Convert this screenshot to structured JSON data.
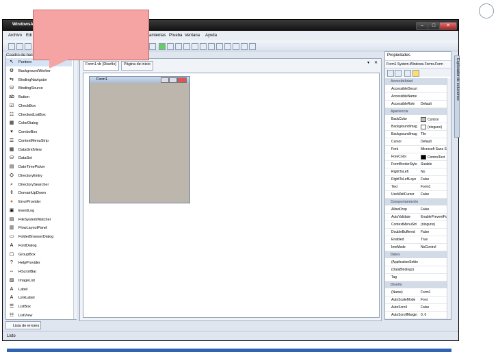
{
  "window": {
    "title": "WindowsAp",
    "min": "–",
    "max": "□",
    "close": "✕"
  },
  "menu": [
    "Archivo",
    "Edi",
    "ramientas",
    "Prueba",
    "Ventana",
    "Ayuda"
  ],
  "toolbox": {
    "header": "Cuadro de herra",
    "items": [
      {
        "label": "Puntero",
        "icon": "pointer-icon",
        "glyph": "↖"
      },
      {
        "label": "BackgroundWorker",
        "icon": "worker-icon",
        "glyph": "⚙"
      },
      {
        "label": "BindingNavigator",
        "icon": "navigator-icon",
        "glyph": "⇆"
      },
      {
        "label": "BindingSource",
        "icon": "source-icon",
        "glyph": "⛁"
      },
      {
        "label": "Button",
        "icon": "button-icon",
        "glyph": "ab"
      },
      {
        "label": "CheckBox",
        "icon": "checkbox-icon",
        "glyph": "☑"
      },
      {
        "label": "CheckedListBox",
        "icon": "checkedlist-icon",
        "glyph": "☷"
      },
      {
        "label": "ColorDialog",
        "icon": "color-icon",
        "glyph": "▦"
      },
      {
        "label": "ComboBox",
        "icon": "combobox-icon",
        "glyph": "▾"
      },
      {
        "label": "ContextMenuStrip",
        "icon": "contextmenu-icon",
        "glyph": "☰"
      },
      {
        "label": "DataGridView",
        "icon": "grid-icon",
        "glyph": "▦"
      },
      {
        "label": "DataSet",
        "icon": "dataset-icon",
        "glyph": "⛁"
      },
      {
        "label": "DateTimePicker",
        "icon": "calendar-icon",
        "glyph": "▤"
      },
      {
        "label": "DirectoryEntry",
        "icon": "directory-icon",
        "glyph": "⛭"
      },
      {
        "label": "DirectorySearcher",
        "icon": "search-icon",
        "glyph": "⌕"
      },
      {
        "label": "DomainUpDown",
        "icon": "updown-icon",
        "glyph": "⇕"
      },
      {
        "label": "ErrorProvider",
        "icon": "error-icon",
        "glyph": "●"
      },
      {
        "label": "EventLog",
        "icon": "eventlog-icon",
        "glyph": "▣"
      },
      {
        "label": "FileSystemWatcher",
        "icon": "watcher-icon",
        "glyph": "▤"
      },
      {
        "label": "FlowLayoutPanel",
        "icon": "flow-icon",
        "glyph": "▥"
      },
      {
        "label": "FolderBrowserDialog",
        "icon": "folder-icon",
        "glyph": "▭"
      },
      {
        "label": "FontDialog",
        "icon": "font-icon",
        "glyph": "A"
      },
      {
        "label": "GroupBox",
        "icon": "groupbox-icon",
        "glyph": "▢"
      },
      {
        "label": "HelpProvider",
        "icon": "help-icon",
        "glyph": "?"
      },
      {
        "label": "HScrollBar",
        "icon": "hscroll-icon",
        "glyph": "⇔"
      },
      {
        "label": "ImageList",
        "icon": "imagelist-icon",
        "glyph": "▨"
      },
      {
        "label": "Label",
        "icon": "label-icon",
        "glyph": "A"
      },
      {
        "label": "LinkLabel",
        "icon": "link-icon",
        "glyph": "A"
      },
      {
        "label": "ListBox",
        "icon": "listbox-icon",
        "glyph": "☰"
      },
      {
        "label": "ListView",
        "icon": "listview-icon",
        "glyph": "☷"
      }
    ]
  },
  "designer": {
    "tab1": "Form1.vb [Diseño]",
    "tab2": "Página de inicio",
    "form_title": "Form1",
    "close_x": "✕",
    "pin": "▾"
  },
  "properties": {
    "title": "Propiedades",
    "object": "Form1 System.Windows.Forms.Form",
    "rows": [
      {
        "cat": "Accesibilidad"
      },
      {
        "n": "AccessibleDescri",
        "v": ""
      },
      {
        "n": "AccessibleName",
        "v": ""
      },
      {
        "n": "AccessibleRole",
        "v": "Default"
      },
      {
        "cat": "Apariencia"
      },
      {
        "n": "BackColor",
        "v": "Control",
        "swatch": "#c0c0c0"
      },
      {
        "n": "BackgroundImag",
        "v": "(ninguno)",
        "swatch": "#ffffff"
      },
      {
        "n": "BackgroundImag",
        "v": "Tile"
      },
      {
        "n": "Cursor",
        "v": "Default"
      },
      {
        "n": "Font",
        "v": "Microsoft Sans Se"
      },
      {
        "n": "ForeColor",
        "v": "ControlText",
        "swatch": "#000000"
      },
      {
        "n": "FormBorderStyle",
        "v": "Sizable"
      },
      {
        "n": "RightToLeft",
        "v": "No"
      },
      {
        "n": "RightToLeftLayo",
        "v": "False"
      },
      {
        "n": "Text",
        "v": "Form1"
      },
      {
        "n": "UseWaitCursor",
        "v": "False"
      },
      {
        "cat": "Comportamiento"
      },
      {
        "n": "AllowDrop",
        "v": "False"
      },
      {
        "n": "AutoValidate",
        "v": "EnablePreventFoc"
      },
      {
        "n": "ContextMenuStri",
        "v": "(ninguno)"
      },
      {
        "n": "DoubleBuffered",
        "v": "False"
      },
      {
        "n": "Enabled",
        "v": "True"
      },
      {
        "n": "ImeMode",
        "v": "NoControl"
      },
      {
        "cat": "Datos"
      },
      {
        "n": "(ApplicationSettin",
        "v": ""
      },
      {
        "n": "(DataBindings)",
        "v": ""
      },
      {
        "n": "Tag",
        "v": ""
      },
      {
        "cat": "Diseño"
      },
      {
        "n": "(Name)",
        "v": "Form1"
      },
      {
        "n": "AutoScaleMode",
        "v": "Font"
      },
      {
        "n": "AutoScroll",
        "v": "False"
      },
      {
        "n": "AutoScrollMargin",
        "v": "0, 0"
      }
    ]
  },
  "side_tab": "Explorador de soluciones",
  "error_tab": "Lista de errores",
  "status": "Listo"
}
